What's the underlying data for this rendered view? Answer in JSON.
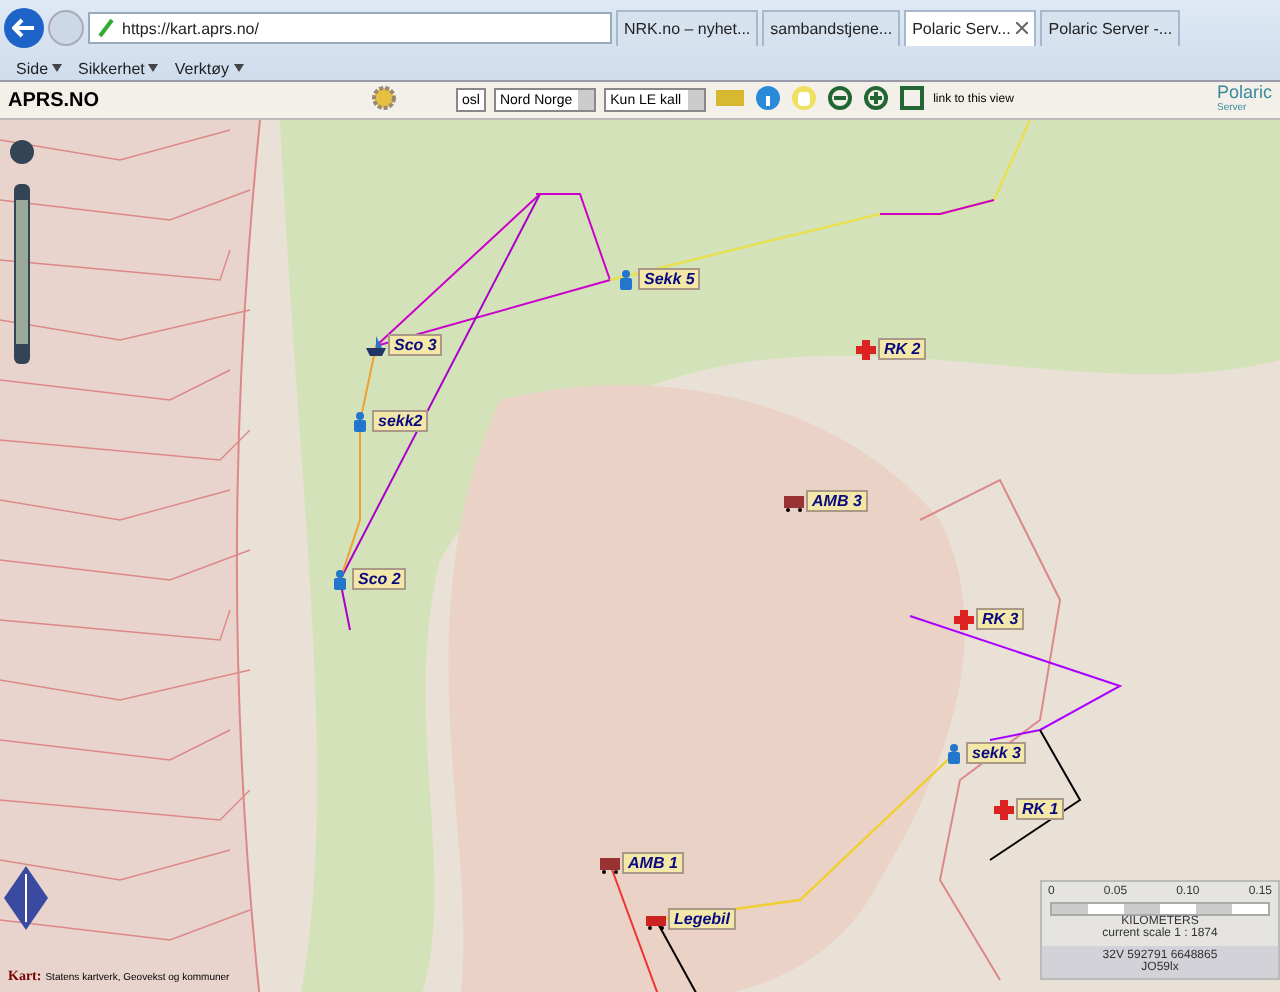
{
  "browser": {
    "address": "https://kart.aprs.no/",
    "tabs": [
      {
        "label": "NRK.no – nyhet...",
        "selected": false
      },
      {
        "label": "sambandstjene...",
        "selected": false
      },
      {
        "label": "Polaric Serv...",
        "selected": true
      },
      {
        "label": "Polaric Server -...",
        "selected": false
      }
    ],
    "menu": [
      "Side",
      "Sikkerhet",
      "Verktøy"
    ]
  },
  "app": {
    "title": "APRS.NO",
    "search": "osl",
    "area": "Nord Norge",
    "filter": "Kun LE kall",
    "link": "link to this view",
    "logo": "Polaric",
    "logo_sub": "Server"
  },
  "map": {
    "stations": [
      {
        "label": "Sekk 5",
        "kind": "person"
      },
      {
        "label": "Sco 3",
        "kind": "boat"
      },
      {
        "label": "sekk2",
        "kind": "person"
      },
      {
        "label": "Sco 2",
        "kind": "person"
      },
      {
        "label": "RK 2",
        "kind": "cross"
      },
      {
        "label": "AMB 3",
        "kind": "ambulance"
      },
      {
        "label": "RK 3",
        "kind": "cross"
      },
      {
        "label": "sekk 3",
        "kind": "person"
      },
      {
        "label": "RK 1",
        "kind": "cross"
      },
      {
        "label": "AMB 1",
        "kind": "ambulance"
      },
      {
        "label": "Legebil",
        "kind": "car"
      }
    ],
    "scale": {
      "ticks": [
        "0",
        "0.05",
        "0.10",
        "0.15"
      ],
      "unit": "KILOMETERS",
      "current": "current scale 1 : 1874",
      "coords": "32V 592791 6648865",
      "locator": "JO59lx"
    },
    "attribution": {
      "label": "Kart:",
      "text": "Statens kartverk, Geovekst og kommuner"
    }
  }
}
